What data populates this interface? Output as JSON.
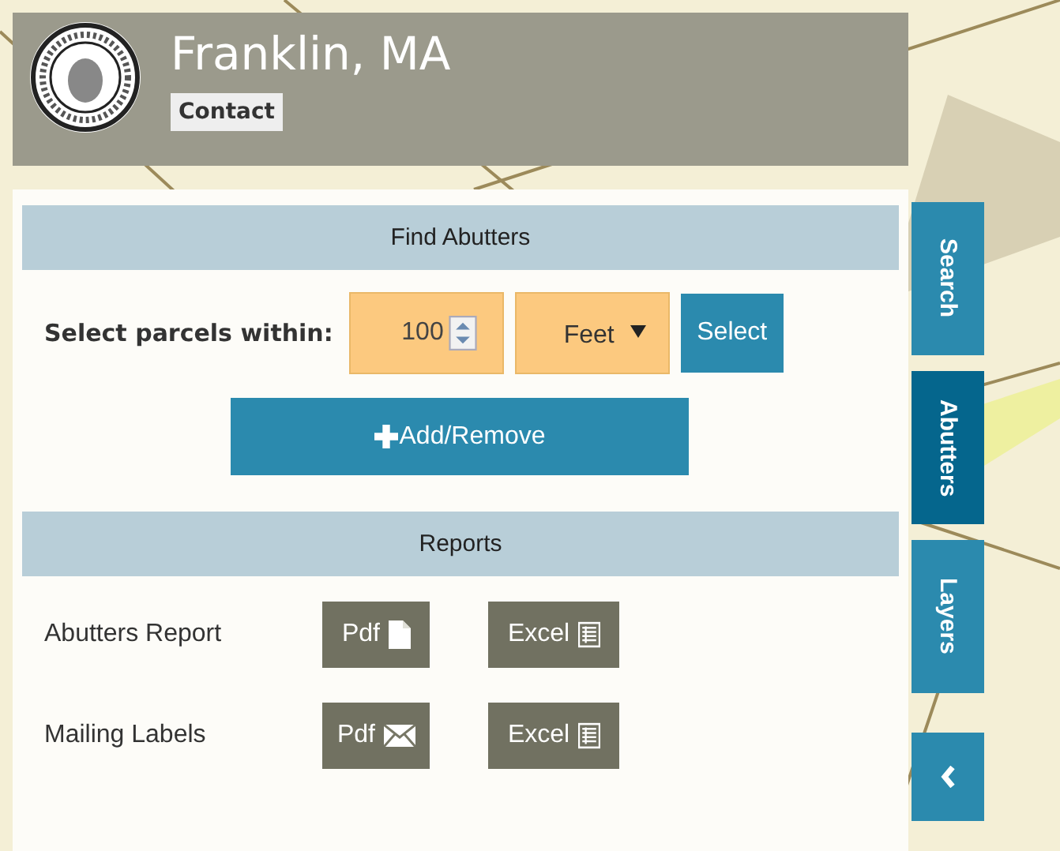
{
  "header": {
    "title": "Franklin, MA",
    "contact_button": "Contact"
  },
  "find_abutters": {
    "heading": "Find Abutters",
    "label": "Select parcels within:",
    "distance": "100",
    "unit": "Feet",
    "select_button": "Select",
    "add_remove_button": "Add/Remove"
  },
  "reports": {
    "heading": "Reports",
    "rows": [
      {
        "label": "Abutters Report",
        "buttons": [
          {
            "label": "Pdf",
            "kind": "document"
          },
          {
            "label": "Excel",
            "kind": "sheet"
          }
        ]
      },
      {
        "label": "Mailing Labels",
        "buttons": [
          {
            "label": "Pdf",
            "kind": "mail"
          },
          {
            "label": "Excel",
            "kind": "sheet"
          }
        ]
      }
    ]
  },
  "side_tabs": [
    {
      "label": "Search",
      "selected": false
    },
    {
      "label": "Abutters",
      "selected": true
    },
    {
      "label": "Layers",
      "selected": false
    }
  ]
}
